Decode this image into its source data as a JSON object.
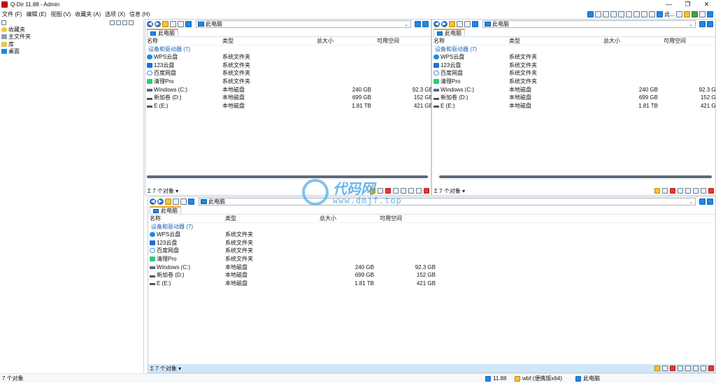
{
  "window": {
    "title": "Q-Dir 11.88 - Admin",
    "buttons": [
      "—",
      "❐",
      "✕"
    ]
  },
  "menu": [
    "文件 (F)",
    "编辑 (E)",
    "视图 (V)",
    "收藏夹 (A)",
    "选项 (X)",
    "信息 (H)"
  ],
  "toolbar_right_label": "此...",
  "tree": {
    "items": [
      {
        "label": "收藏夹",
        "icon": "star-icon"
      },
      {
        "label": "主文件夹",
        "icon": "home-icon"
      },
      {
        "label": "库",
        "icon": "folder-icon"
      },
      {
        "label": "桌面",
        "icon": "desktop-icon"
      }
    ]
  },
  "pane": {
    "address": "此电脑",
    "tab": "此电脑",
    "columns": {
      "name": "名称",
      "type": "类型",
      "size": "总大小",
      "free": "可用空间"
    },
    "group": "设备和驱动器 (7)",
    "rows": [
      {
        "name": "WPS云盘",
        "type": "系统文件夹",
        "size": "",
        "free": "",
        "icon": "ic-cloud"
      },
      {
        "name": "123云盘",
        "type": "系统文件夹",
        "size": "",
        "free": "",
        "icon": "ic-123"
      },
      {
        "name": "百度网盘",
        "type": "系统文件夹",
        "size": "",
        "free": "",
        "icon": "ic-baidu"
      },
      {
        "name": "清理Pro",
        "type": "系统文件夹",
        "size": "",
        "free": "",
        "icon": "ic-clean"
      },
      {
        "name": "Windows (C:)",
        "type": "本地磁盘",
        "size": "240 GB",
        "free": "92.3 GB",
        "icon": "ic-win"
      },
      {
        "name": "新加卷 (D:)",
        "type": "本地磁盘",
        "size": "699 GB",
        "free": "152 GB",
        "icon": "ic-drive"
      },
      {
        "name": "E (E:)",
        "type": "本地磁盘",
        "size": "1.81 TB",
        "free": "421 GB",
        "icon": "ic-drive"
      }
    ],
    "status": "7 个对象"
  },
  "bottom": {
    "left": "7 个对象",
    "version": "11.88",
    "user": "wbf (便携版x64)",
    "location": "此电脑"
  },
  "watermark": {
    "title": "代码网",
    "url": "www.dmjf.top"
  }
}
